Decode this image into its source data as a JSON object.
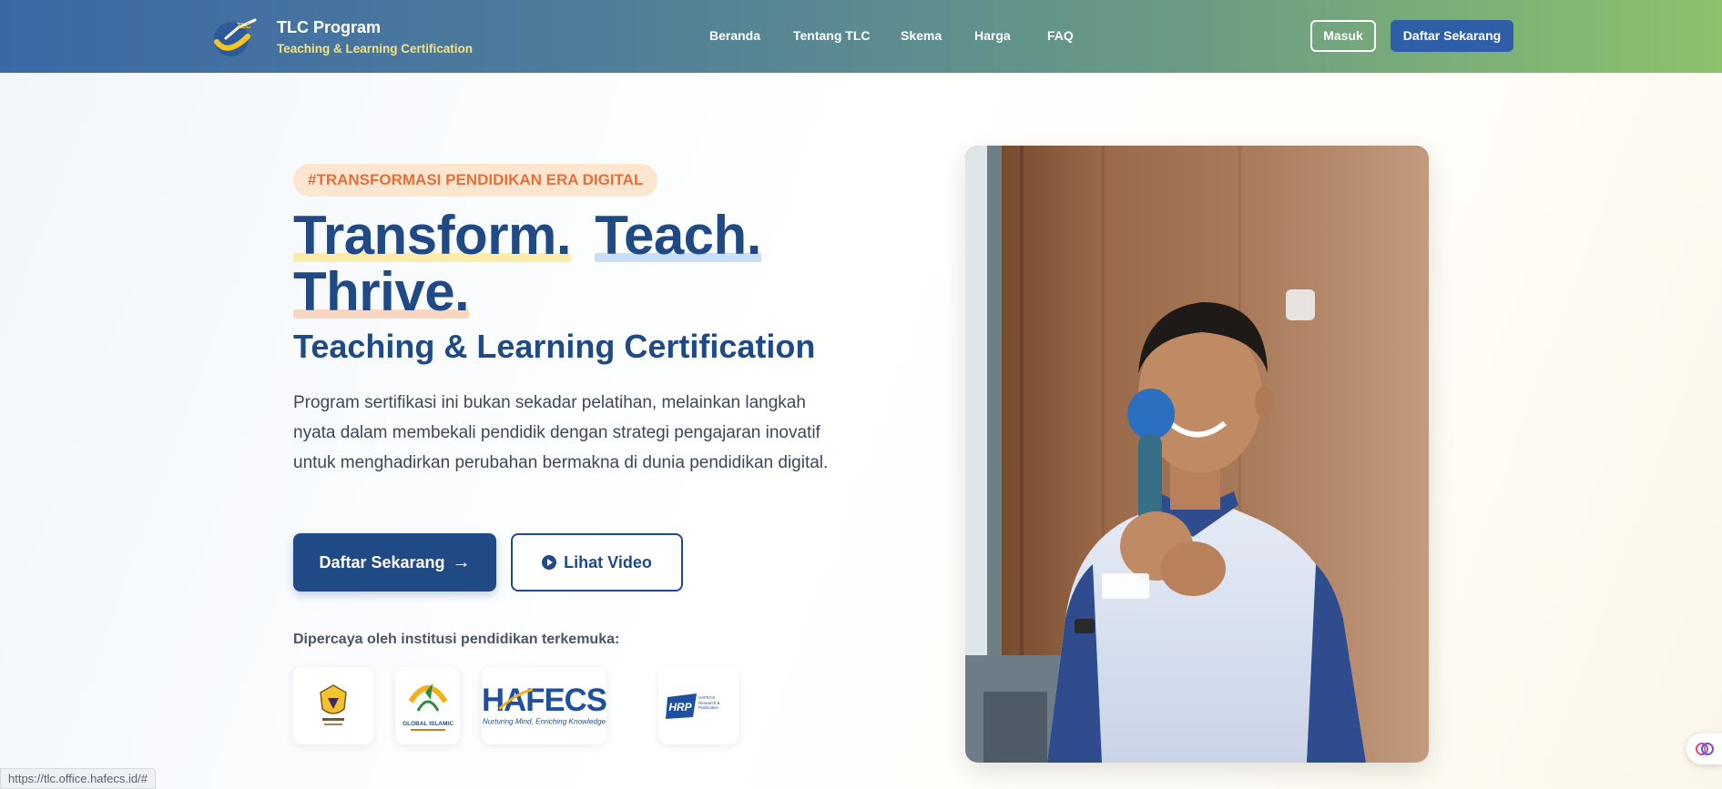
{
  "header": {
    "brand_title": "TLC Program",
    "brand_subtitle": "Teaching & Learning Certification",
    "logo_text": "TLC",
    "nav": [
      "Beranda",
      "Tentang TLC",
      "Skema",
      "Harga",
      "FAQ"
    ],
    "login_label": "Masuk",
    "register_label": "Daftar Sekarang"
  },
  "hero": {
    "tag": "#TRANSFORMASI PENDIDIKAN ERA DIGITAL",
    "headline": [
      "Transform.",
      "Teach.",
      "Thrive."
    ],
    "subheadline": "Teaching & Learning Certification",
    "description": "Program sertifikasi ini bukan sekadar pelatihan, melainkan langkah nyata dalam membekali pendidik dengan strategi pengajaran inovatif untuk menghadirkan perubahan bermakna di dunia pendidikan digital.",
    "cta_primary": "Daftar Sekarang",
    "cta_secondary": "Lihat Video",
    "trusted_label": "Dipercaya oleh institusi pendidikan terkemuka:",
    "partners": [
      {
        "name": "crest-logo"
      },
      {
        "name": "global-islamic-school-logo",
        "caption": "GLOBAL ISLAMIC"
      },
      {
        "name": "hafecs-logo",
        "wordmark": "HAFECS",
        "tagline": "Nurturing Mind, Enriching Knowledge"
      },
      {
        "name": "hrp-logo",
        "wordmark": "HRP",
        "tagline": "HAFECS Research & Publication"
      }
    ]
  },
  "status_bar": {
    "url": "https://tlc.office.hafecs.id/#"
  },
  "colors": {
    "primary": "#1f4a86",
    "accent_yellow": "#f6e27a",
    "tag_text": "#e36f3c",
    "tag_bg": "#fde6cf"
  }
}
